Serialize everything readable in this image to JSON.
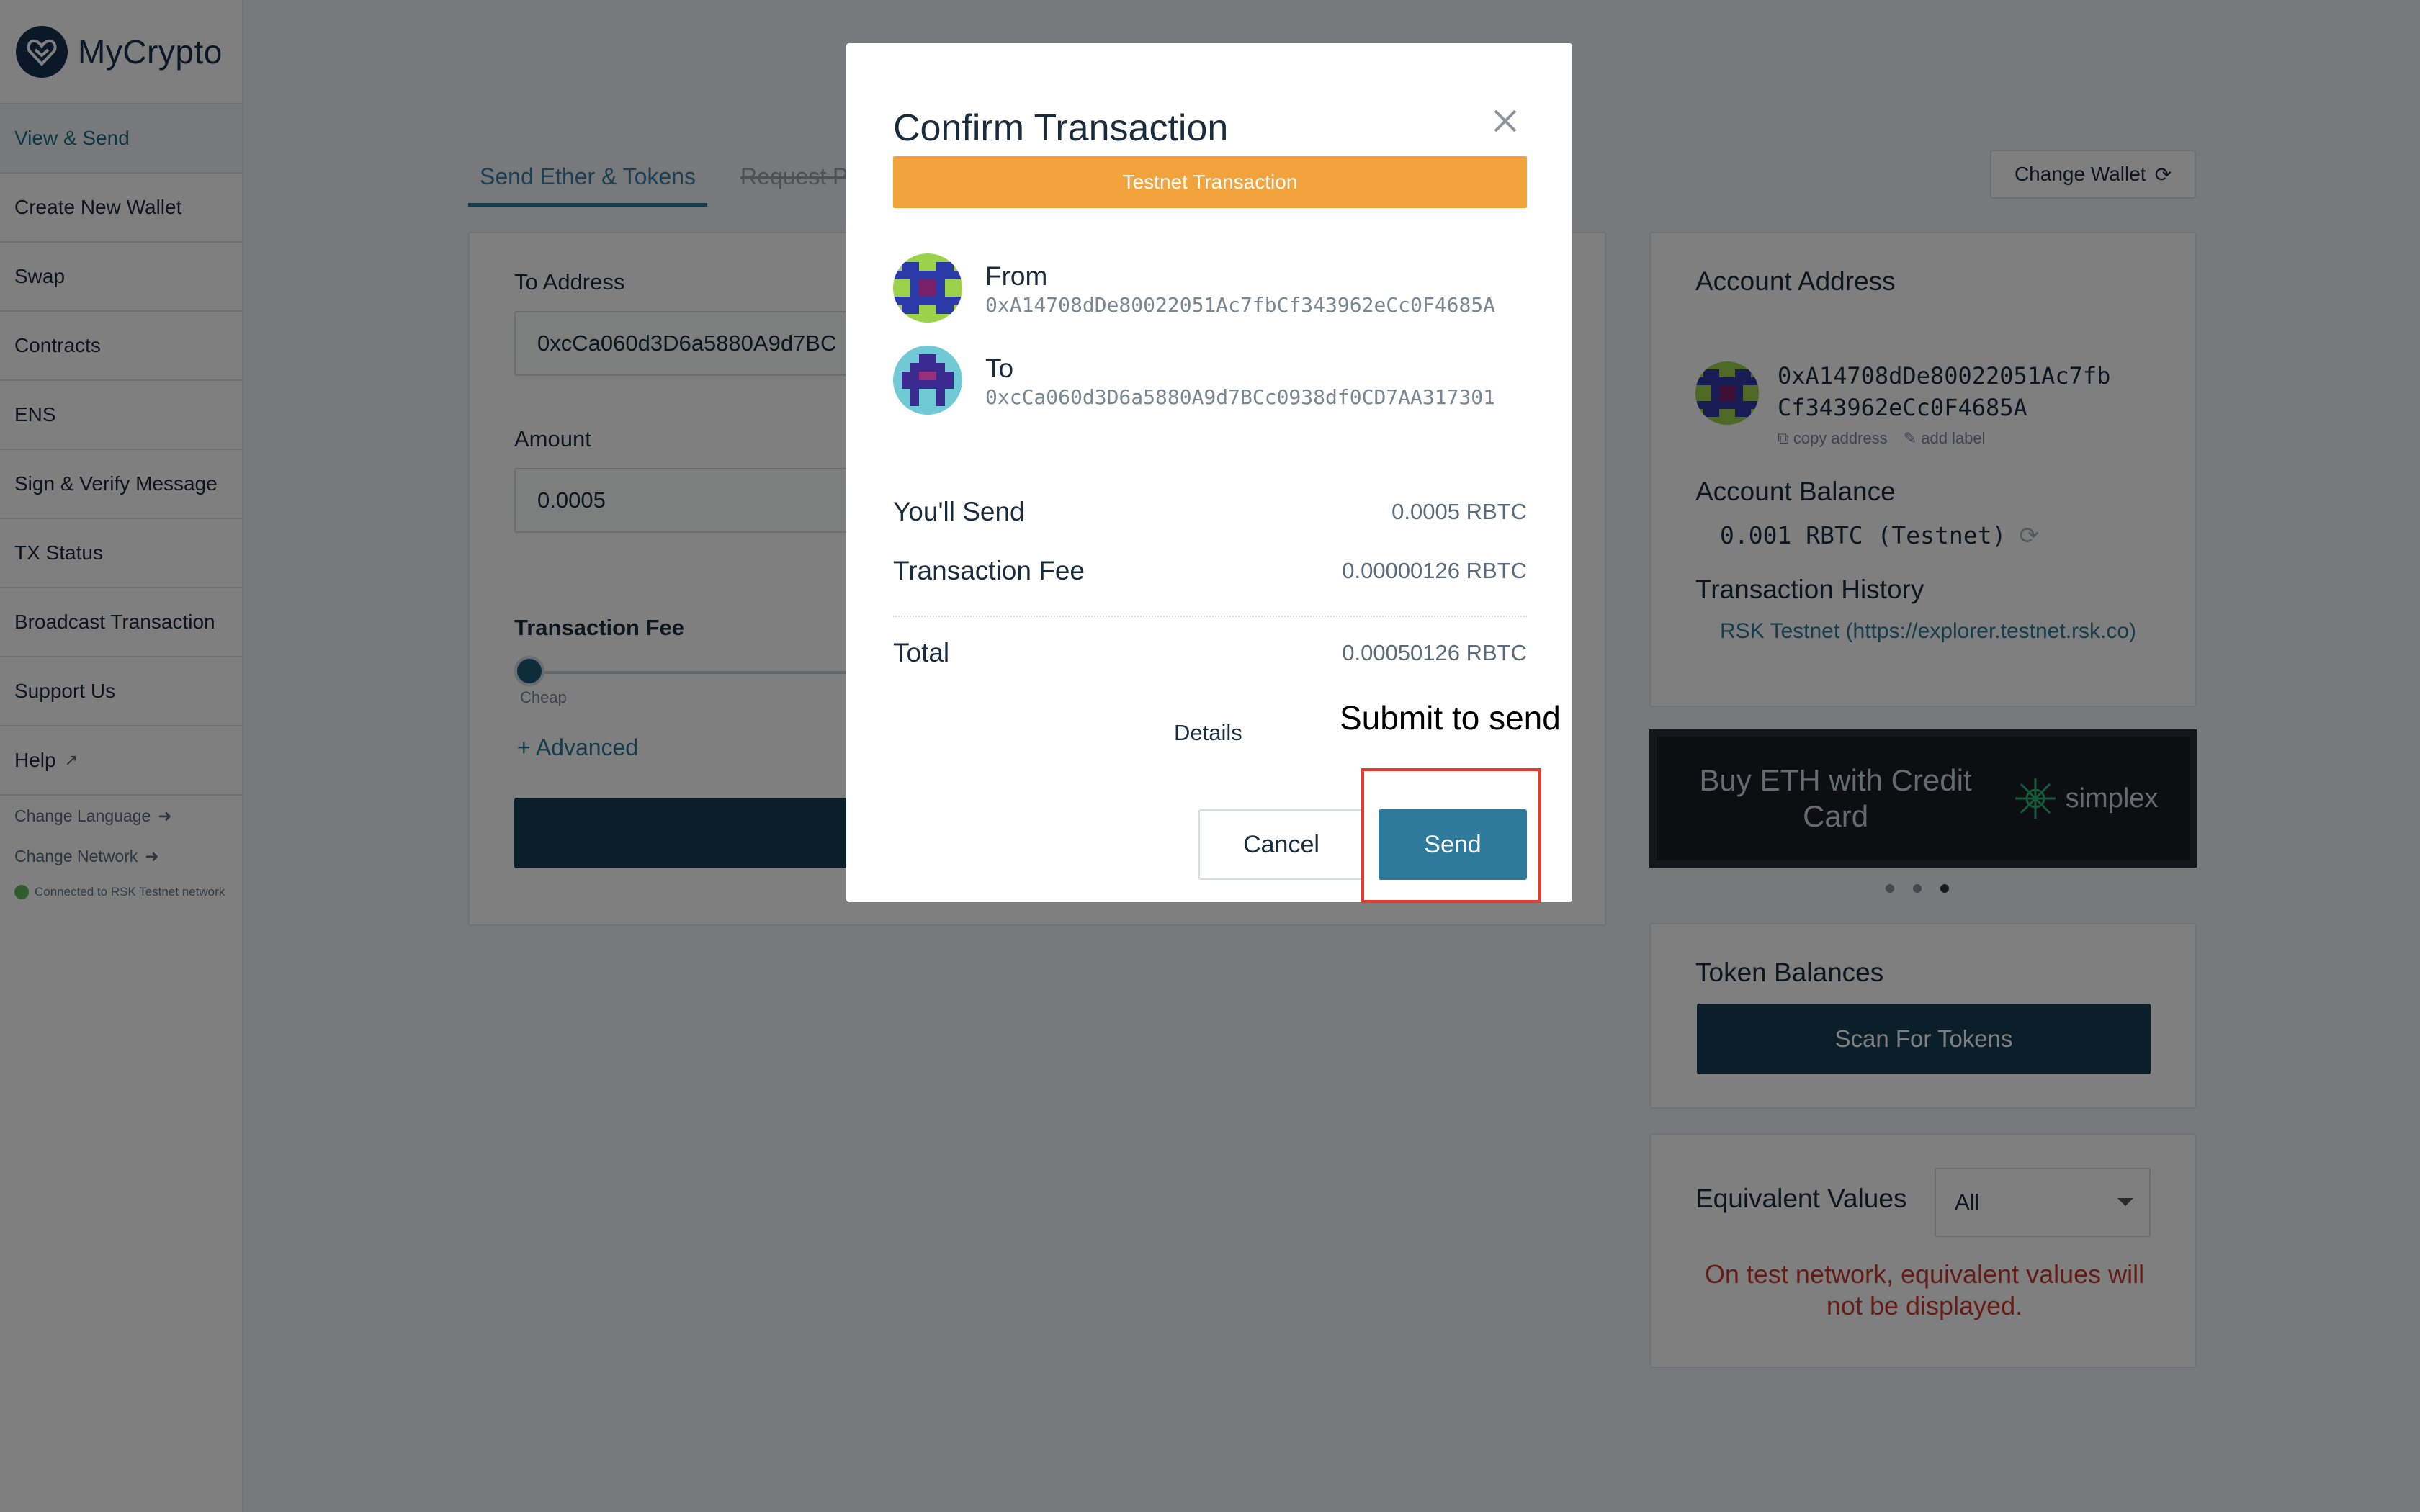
{
  "app": {
    "name": "MyCrypto"
  },
  "sidebar": {
    "items": [
      {
        "label": "View & Send",
        "active": true
      },
      {
        "label": "Create New Wallet"
      },
      {
        "label": "Swap"
      },
      {
        "label": "Contracts"
      },
      {
        "label": "ENS"
      },
      {
        "label": "Sign & Verify Message"
      },
      {
        "label": "TX Status"
      },
      {
        "label": "Broadcast Transaction"
      },
      {
        "label": "Support Us"
      },
      {
        "label": "Help",
        "icon": "external-link-icon"
      }
    ],
    "change_language": "Change Language",
    "change_network": "Change Network",
    "network_status": "Connected to RSK Testnet network",
    "status_color": "#5dba5a"
  },
  "main": {
    "tabs": [
      {
        "label": "Send Ether & Tokens",
        "active": true
      },
      {
        "label": "Request Payment",
        "disabled": true
      }
    ],
    "change_wallet": "Change Wallet",
    "to_address_label": "To Address",
    "to_address_value": "0xcCa060d3D6a5880A9d7BC",
    "amount_label": "Amount",
    "amount_value": "0.0005",
    "fee_label": "Transaction Fee",
    "fee_slider_label": "Cheap",
    "advanced_label": "+ Advanced"
  },
  "account": {
    "title": "Account Address",
    "address_line1": "0xA14708dDe80022051Ac7fb",
    "address_line2": "Cf343962eCc0F4685A",
    "copy_address": "copy address",
    "add_label": "add label",
    "balance_title": "Account Balance",
    "balance_value": "0.001 RBTC (Testnet)",
    "history_title": "Transaction History",
    "history_link": "RSK Testnet (https://explorer.testnet.rsk.co)"
  },
  "banner": {
    "text": "Buy ETH with Credit Card",
    "brand": "simplex",
    "dots": 3,
    "active_dot": 3
  },
  "tokens": {
    "title": "Token Balances",
    "scan_button": "Scan For Tokens"
  },
  "equivalent": {
    "title": "Equivalent Values",
    "select_value": "All",
    "warning": "On test network, equivalent values will not be displayed."
  },
  "modal": {
    "title": "Confirm Transaction",
    "testnet_label": "Testnet Transaction",
    "from_label": "From",
    "from_address": "0xA14708dDe80022051Ac7fbCf343962eCc0F4685A",
    "to_label": "To",
    "to_address": "0xcCa060d3D6a5880A9d7BCc0938df0CD7AA317301",
    "send_label": "You'll Send",
    "send_value": "0.0005 RBTC",
    "fee_label": "Transaction Fee",
    "fee_value": "0.00000126 RBTC",
    "total_label": "Total",
    "total_value": "0.00050126 RBTC",
    "details": "Details",
    "cancel": "Cancel",
    "send": "Send",
    "testnet_color": "#f2a33b",
    "send_color": "#2d7a9a"
  },
  "annotation": {
    "text": "Submit to send",
    "color": "#e53b30"
  }
}
